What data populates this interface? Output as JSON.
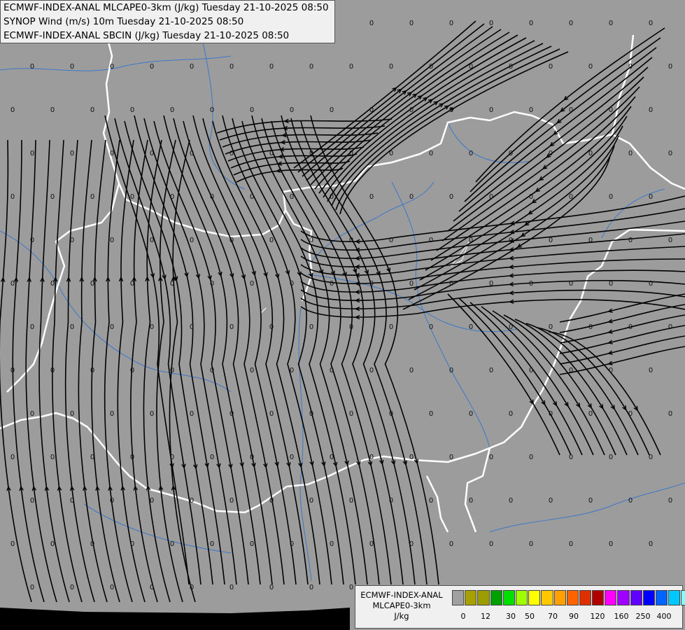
{
  "header": {
    "line1": "ECMWF-INDEX-ANAL MLCAPE0-3km (J/kg) Tuesday 21-10-2025 08:50",
    "line2": "SYNOP Wind (m/s) 10m Tuesday 21-10-2025 08:50",
    "line3": "ECMWF-INDEX-ANAL SBCIN (J/kg) Tuesday 21-10-2025 08:50"
  },
  "legend": {
    "title_line1": "ECMWF-INDEX-ANAL",
    "title_line2": "MLCAPE0-3km",
    "unit": "J/kg",
    "colors": [
      "#a0a0a0",
      "#a8a000",
      "#9c9c00",
      "#00a000",
      "#00e000",
      "#a0ff00",
      "#ffff00",
      "#ffc800",
      "#ffa000",
      "#ff6400",
      "#e03000",
      "#b00000",
      "#ff00ff",
      "#a000ff",
      "#6000ff",
      "#0000ff",
      "#0064ff",
      "#00c8ff",
      "#80ffff",
      "#ffffff"
    ],
    "ticks": [
      "0",
      "12",
      "30",
      "50",
      "70",
      "90",
      "120",
      "160",
      "250",
      "400"
    ]
  },
  "map": {
    "background": "#9c9c9c",
    "border_color": "#ffffff",
    "river_color": "#3c78c8",
    "stream_color": "#000000",
    "station_value": "0"
  }
}
